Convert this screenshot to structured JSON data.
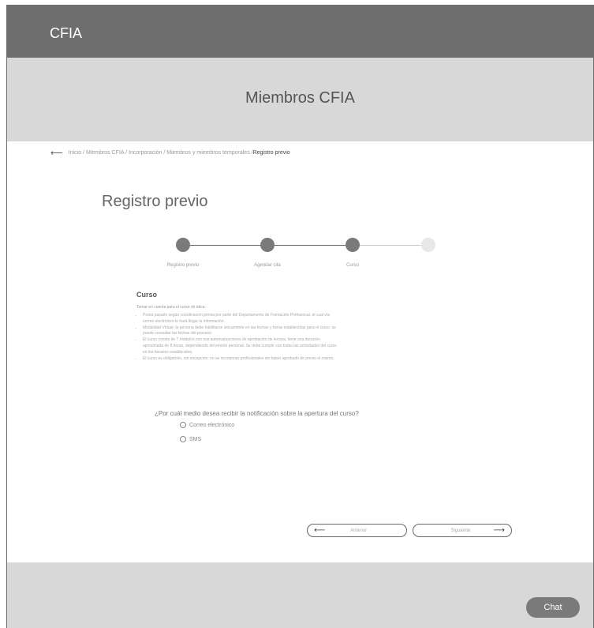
{
  "header": {
    "brand": "CFIA"
  },
  "hero": {
    "title": "Miembros CFIA"
  },
  "breadcrumb": {
    "back_icon": "arrow-left-icon",
    "path": "Inicio / Miembros CFIA / Incorporación / Miembros y miembros temporales / ",
    "current": "Registro previo"
  },
  "page": {
    "title": "Registro previo"
  },
  "stepper": {
    "steps": [
      {
        "label": "Registro previo",
        "state": "done"
      },
      {
        "label": "Agendar cita",
        "state": "done"
      },
      {
        "label": "Curso",
        "state": "current"
      },
      {
        "label": "",
        "state": "pending"
      }
    ]
  },
  "section": {
    "title": "Curso",
    "intro": "Tomar en cuenta para el curso de ética:",
    "bullets": [
      "Podrá pasarlo según coordinación previa por parte del Departamento de Formación Profesional, el cual vía correo electrónico le hará llegar la información.",
      "Modalidad Virtual: la persona debe habilitarse únicamente en las fechas y horas establecidas para el curso; se puede consultar las fechas del proceso.",
      "El curso consta de 7 módulos con sus autoevaluaciones de aprobación de lectura; tiene una duración aproximada de 8 horas, dependiendo del interés personal. Se debe cumplir con todas las actividades del curso en los horarios establecidos.",
      "El curso es obligatorio, sin excepción; no se incorporan profesionales sin haber aprobado de previo el mismo."
    ]
  },
  "notification": {
    "question": "¿Por cuál medio desea recibir la notificación sobre la apertura del curso?",
    "options": [
      "Correo electrónico",
      "SMS"
    ]
  },
  "navigation": {
    "prev_label": "Anterior",
    "next_label": "Siguiente",
    "prev_icon": "arrow-left-icon",
    "next_icon": "arrow-right-icon"
  },
  "chat": {
    "label": "Chat"
  }
}
